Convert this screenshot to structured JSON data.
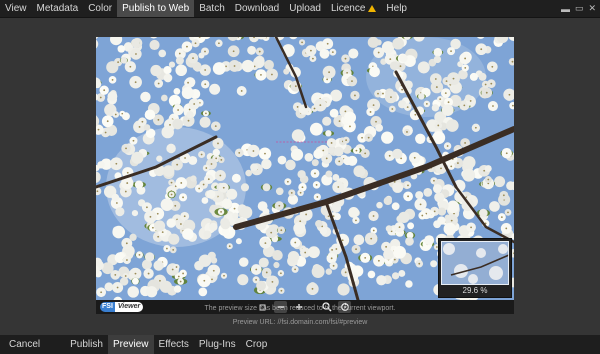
{
  "menu": {
    "items": [
      {
        "label": "View"
      },
      {
        "label": "Metadata"
      },
      {
        "label": "Color"
      },
      {
        "label": "Publish to Web",
        "active": true
      },
      {
        "label": "Batch"
      },
      {
        "label": "Download"
      },
      {
        "label": "Upload"
      },
      {
        "label": "Licence",
        "warning": true
      },
      {
        "label": "Help"
      }
    ]
  },
  "window_controls": {
    "minimize": "▬",
    "restore": "▭",
    "close": "✕"
  },
  "viewer": {
    "logo": {
      "prefix": "FSI",
      "suffix": "Viewer"
    },
    "zoom_label": "29.6 %",
    "toolbar_icons": [
      "stop-icon",
      "zoom-out-icon",
      "zoom-in-icon",
      "magnifier-icon",
      "rotate-icon"
    ]
  },
  "info": {
    "note": "The preview size has been reduced to fit the current viewport.",
    "preview_url_label": "Preview URL:",
    "preview_url": "//fsi.domain.com/fsi/#preview"
  },
  "bottom": {
    "items": [
      {
        "label": "Cancel"
      },
      {
        "label": "Publish"
      },
      {
        "label": "Preview",
        "active": true
      },
      {
        "label": "Effects"
      },
      {
        "label": "Plug-Ins"
      },
      {
        "label": "Crop"
      }
    ]
  },
  "colors": {
    "sky": "#7ea4d6",
    "blossom": "#f4f3ee",
    "branch": "#3a2d24",
    "leaf": "#5e7f2c"
  }
}
